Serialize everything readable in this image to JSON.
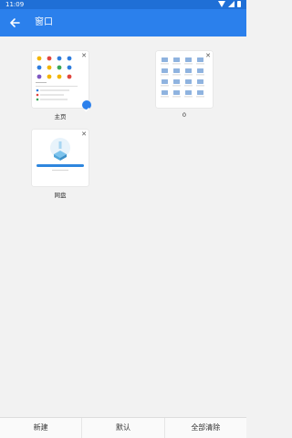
{
  "status_bar": {
    "time": "11:09"
  },
  "app_bar": {
    "title": "窗口"
  },
  "windows": [
    {
      "label": "主页",
      "selected": true
    },
    {
      "label": "0",
      "selected": false
    },
    {
      "label": "网盘",
      "selected": false
    }
  ],
  "bottom_bar": {
    "new_label": "新建",
    "default_label": "默认",
    "clear_label": "全部清除"
  },
  "colors": {
    "accent": "#2b80ec",
    "status_bar": "#1f6fd6"
  }
}
